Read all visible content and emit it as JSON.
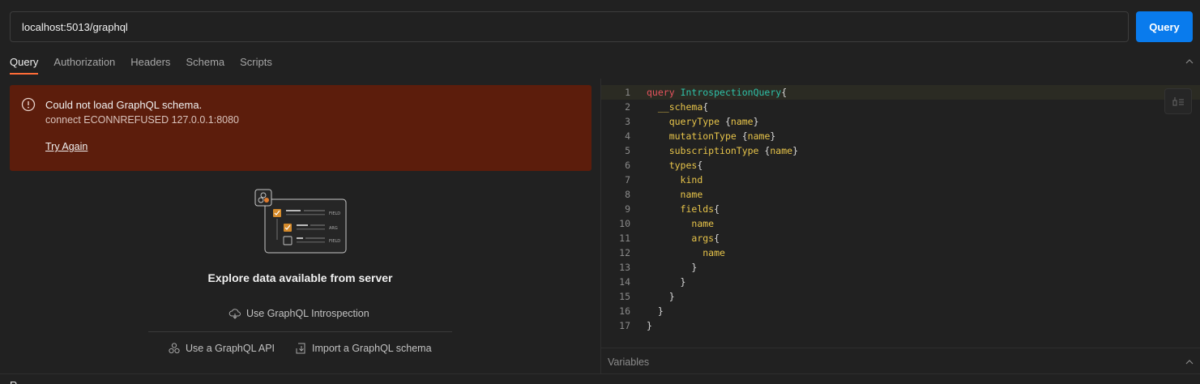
{
  "url": {
    "value": "localhost:5013/graphql"
  },
  "toolbar": {
    "query_label": "Query"
  },
  "tabs": [
    {
      "label": "Query",
      "active": true
    },
    {
      "label": "Authorization",
      "active": false
    },
    {
      "label": "Headers",
      "active": false
    },
    {
      "label": "Schema",
      "active": false
    },
    {
      "label": "Scripts",
      "active": false
    }
  ],
  "error": {
    "icon": "alert-circle-icon",
    "title": "Could not load GraphQL schema.",
    "detail": "connect ECONNREFUSED 127.0.0.1:8080",
    "retry": "Try Again"
  },
  "explore": {
    "illustration": "schema-explorer-illustration",
    "illustration_labels": [
      "FIELD",
      "ARG",
      "FIELD"
    ],
    "title": "Explore data available from server",
    "introspection": "Use GraphQL Introspection",
    "api": "Use a GraphQL API",
    "import": "Import a GraphQL schema"
  },
  "editor": {
    "line_numbers": [
      "1",
      "2",
      "3",
      "4",
      "5",
      "6",
      "7",
      "8",
      "9",
      "10",
      "11",
      "12",
      "13",
      "14",
      "15",
      "16",
      "17"
    ]
  },
  "variables": {
    "label": "Variables"
  },
  "bottom": {
    "label": "R"
  },
  "colors": {
    "accent": "#097bed",
    "tab_underline": "#ff6c37",
    "error_bg": "#5c1d0c"
  }
}
